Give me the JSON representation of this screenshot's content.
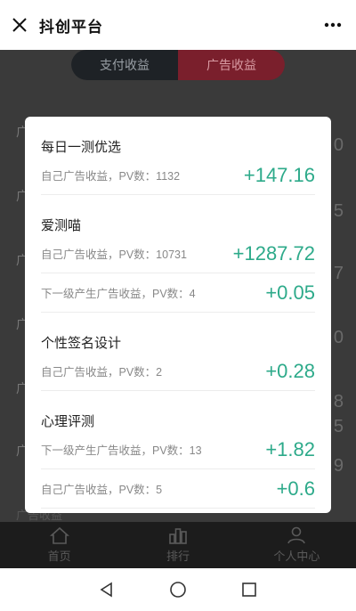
{
  "header": {
    "title": "抖创平台"
  },
  "background": {
    "tabs": [
      "支付收益",
      "广告收益"
    ],
    "rows": [
      {
        "label": "广",
        "value": "0"
      },
      {
        "label": "广",
        "value": "5"
      },
      {
        "label": "广",
        "value": "7"
      },
      {
        "label": "广",
        "value": "0"
      },
      {
        "label": "广",
        "value": "8"
      },
      {
        "label": "广",
        "value": "5"
      },
      {
        "label": "广",
        "value": "9"
      }
    ],
    "footnote": "广告收益"
  },
  "tabbar": {
    "items": [
      "首页",
      "排行",
      "个人中心"
    ]
  },
  "modal": {
    "groups": [
      {
        "title": "每日一测优选",
        "items": [
          {
            "label": "自己广告收益，PV数：1132",
            "value": "+147.16"
          }
        ]
      },
      {
        "title": "爱测喵",
        "items": [
          {
            "label": "自己广告收益，PV数：10731",
            "value": "+1287.72"
          },
          {
            "label": "下一级产生广告收益，PV数：4",
            "value": "+0.05"
          }
        ]
      },
      {
        "title": "个性签名设计",
        "items": [
          {
            "label": "自己广告收益，PV数：2",
            "value": "+0.28"
          }
        ]
      },
      {
        "title": "心理评测",
        "items": [
          {
            "label": "下一级产生广告收益，PV数：13",
            "value": "+1.82"
          },
          {
            "label": "自己广告收益，PV数：5",
            "value": "+0.6"
          }
        ]
      }
    ]
  },
  "colors": {
    "accent": "#2daa8a",
    "overlay": "#3a3a3a"
  }
}
